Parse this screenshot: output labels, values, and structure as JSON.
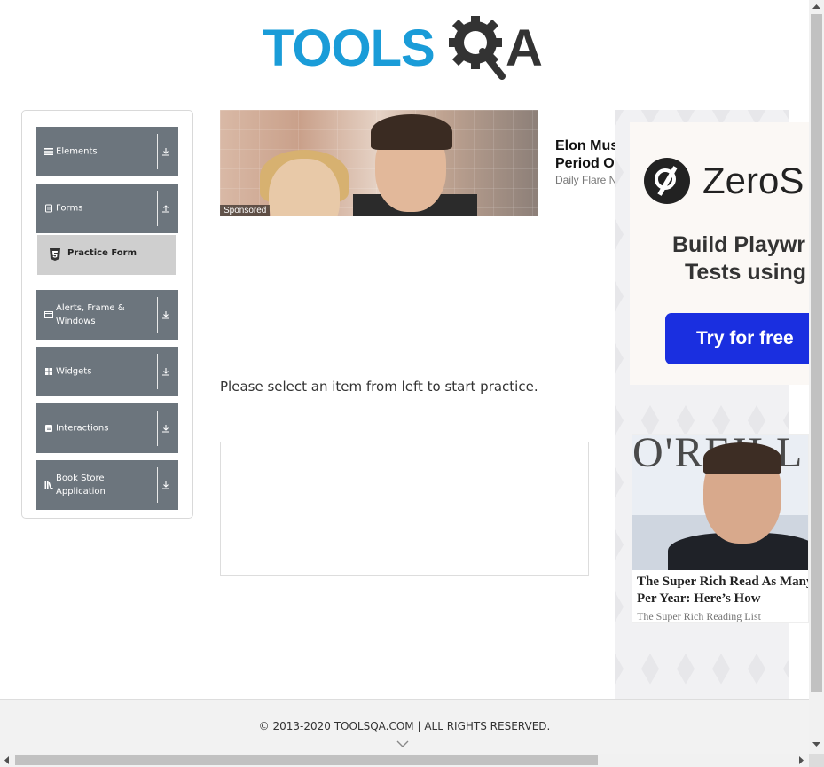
{
  "header": {
    "logo_text_left": "TOOLS",
    "logo_text_right": "A",
    "brand_color": "#1a9cd8"
  },
  "sidebar": {
    "groups": [
      {
        "label": "Elements",
        "icon": "menu-icon",
        "arrow": "download-icon"
      },
      {
        "label": "Forms",
        "icon": "form-icon",
        "arrow": "upload-icon"
      },
      {
        "label": "Alerts, Frame & Windows",
        "icon": "window-icon",
        "arrow": "download-icon"
      },
      {
        "label": "Widgets",
        "icon": "widgets-icon",
        "arrow": "download-icon"
      },
      {
        "label": "Interactions",
        "icon": "interactions-icon",
        "arrow": "download-icon"
      },
      {
        "label": "Book Store Application",
        "icon": "library-icon",
        "arrow": "download-icon"
      }
    ],
    "forms_items": [
      {
        "label": "Practice Form",
        "icon": "html5-icon"
      }
    ],
    "group_color": "#6c757d"
  },
  "ad_banner": {
    "sponsored_label": "Sponsored",
    "title_line1": "Elon Mus",
    "title_line2": "Period O",
    "source": "Daily Flare N"
  },
  "main": {
    "instruction": "Please select an item from left to start practice."
  },
  "right_ads": {
    "zero": {
      "brand": "ZeroS",
      "line1": "Build Playwr",
      "line2": "Tests using",
      "cta": "Try for free",
      "cta_color": "#1a2fe0"
    },
    "rich": {
      "photo_sign": "O'REILL",
      "title_line1": "The Super Rich Read As Many",
      "title_line2": "Per Year: Here’s How",
      "source": "The Super Rich Reading List"
    }
  },
  "footer": {
    "copyright": "© 2013-2020 TOOLSQA.COM | ALL RIGHTS RESERVED."
  }
}
